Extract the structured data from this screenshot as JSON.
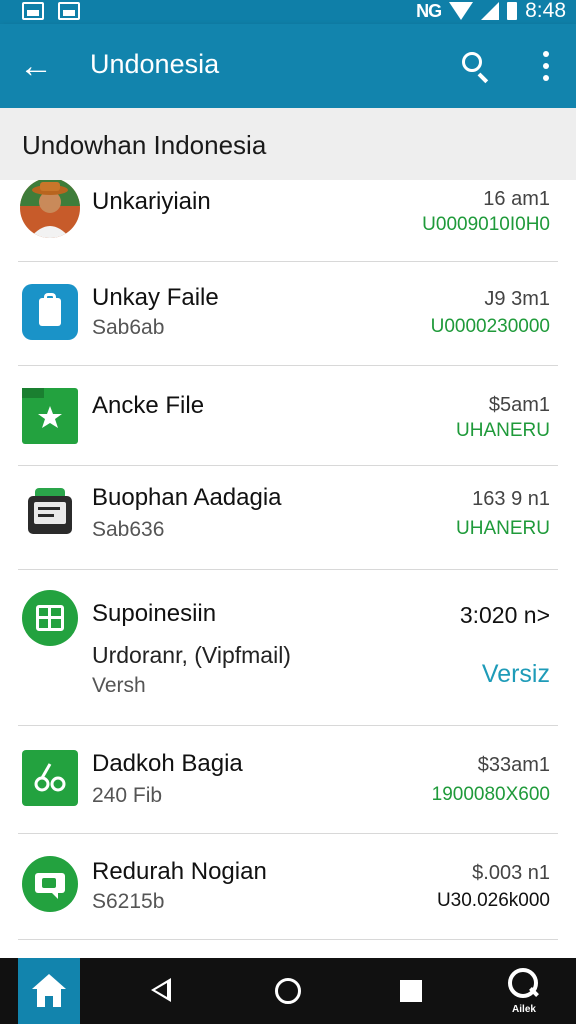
{
  "status_bar": {
    "network": "NG",
    "time": "8:48"
  },
  "app_bar": {
    "title": "Undonesia"
  },
  "section": {
    "title": "Undowhan Indonesia"
  },
  "items": [
    {
      "title": "Unkariyiain",
      "subtitle": "",
      "subtitle2": "",
      "time": "16 am1",
      "status": "U0009010I0H0",
      "icon": "avatar"
    },
    {
      "title": "Unkay Faile",
      "subtitle": "Sab6ab",
      "subtitle2": "",
      "time": "J9 3m1",
      "status": "U0000230000",
      "icon": "file-icon"
    },
    {
      "title": "Ancke File",
      "subtitle": "",
      "subtitle2": "",
      "time": "$5am1",
      "status": "UHANERU",
      "icon": "folder-star-icon"
    },
    {
      "title": "Buophan Aadagia",
      "subtitle": "Sab636",
      "subtitle2": "",
      "time": "163 9 n1",
      "status": "UHANERU",
      "icon": "terminal-icon"
    },
    {
      "title": "Supoinesiin",
      "subtitle": "Urdoranr, (Vipfmail)",
      "subtitle2": "Versh",
      "time": "3:020 n>",
      "status": "Versiz",
      "icon": "signpost-icon"
    },
    {
      "title": "Dadkoh Bagia",
      "subtitle": "240 Fib",
      "subtitle2": "",
      "time": "$33am1",
      "status": "1900080X600",
      "icon": "share-icon"
    },
    {
      "title": "Redurah Nogian",
      "subtitle": "S6215b",
      "subtitle2": "",
      "time": "$.003 n1",
      "status": "U30.026k000",
      "icon": "chat-icon"
    }
  ],
  "bottom_nav": {
    "assist_label": "Ailek"
  },
  "colors": {
    "primary": "#1284ad",
    "accent_green": "#1f9a3a",
    "link": "#1e9bb8"
  }
}
